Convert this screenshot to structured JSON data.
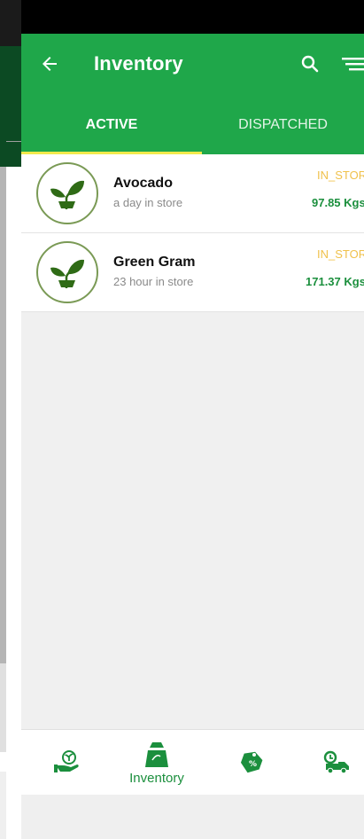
{
  "app": {
    "title": "Inventory"
  },
  "tabs": [
    {
      "label": "ACTIVE"
    },
    {
      "label": "DISPATCHED"
    }
  ],
  "items": [
    {
      "name": "Avocado",
      "subtitle": "a day in store",
      "status": "IN_STORE",
      "quantity": "97.85 Kgs",
      "icon": "plant-icon"
    },
    {
      "name": "Green Gram",
      "subtitle": "23 hour in store",
      "status": "IN_STORE",
      "quantity": "171.37 Kgs",
      "icon": "plant-icon"
    }
  ],
  "bottom_nav": [
    {
      "label": "",
      "icon": "hand-plant-icon"
    },
    {
      "label": "Inventory",
      "icon": "sack-icon"
    },
    {
      "label": "",
      "icon": "price-tag-icon"
    },
    {
      "label": "",
      "icon": "delivery-truck-icon"
    }
  ],
  "colors": {
    "primary": "#1fa74a",
    "indicator": "#f2e94c",
    "status": "#f0c14b",
    "quantity": "#1b8f3d"
  }
}
